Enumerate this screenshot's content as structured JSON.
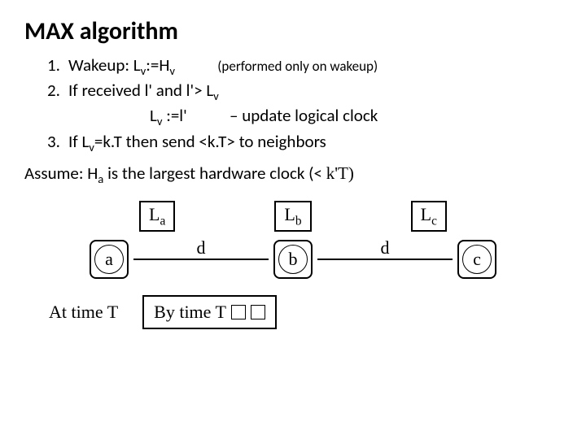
{
  "title": "MAX algorithm",
  "steps": {
    "s1": {
      "num": "1.",
      "text_a": "Wakeup: L",
      "sub_a": "v",
      "text_b": ":=H",
      "sub_b": "v",
      "note": "(performed only on wakeup)"
    },
    "s2": {
      "num": "2.",
      "text_a": "If received l' and l'> L",
      "sub_a": "v",
      "line2_a": "L",
      "line2_sub": "v",
      "line2_b": " :=l'",
      "line2_note": "– update logical clock"
    },
    "s3": {
      "num": "3.",
      "text_a": "If L",
      "sub_a": "v",
      "text_b": "=k.T then send <k.T> to neighbors"
    }
  },
  "assume": {
    "pre": "Assume: H",
    "sub": "a",
    "post": " is the largest hardware clock (< ",
    "tail": "k'T)"
  },
  "labels": {
    "La_pre": "L",
    "La_sub": "a",
    "Lb_pre": "L",
    "Lb_sub": "b",
    "Lc_pre": "L",
    "Lc_sub": "c"
  },
  "nodes": {
    "a": "a",
    "b": "b",
    "c": "c"
  },
  "edges": {
    "d1": "d",
    "d2": "d"
  },
  "footer": {
    "at": "At time T",
    "by": "By time T"
  }
}
